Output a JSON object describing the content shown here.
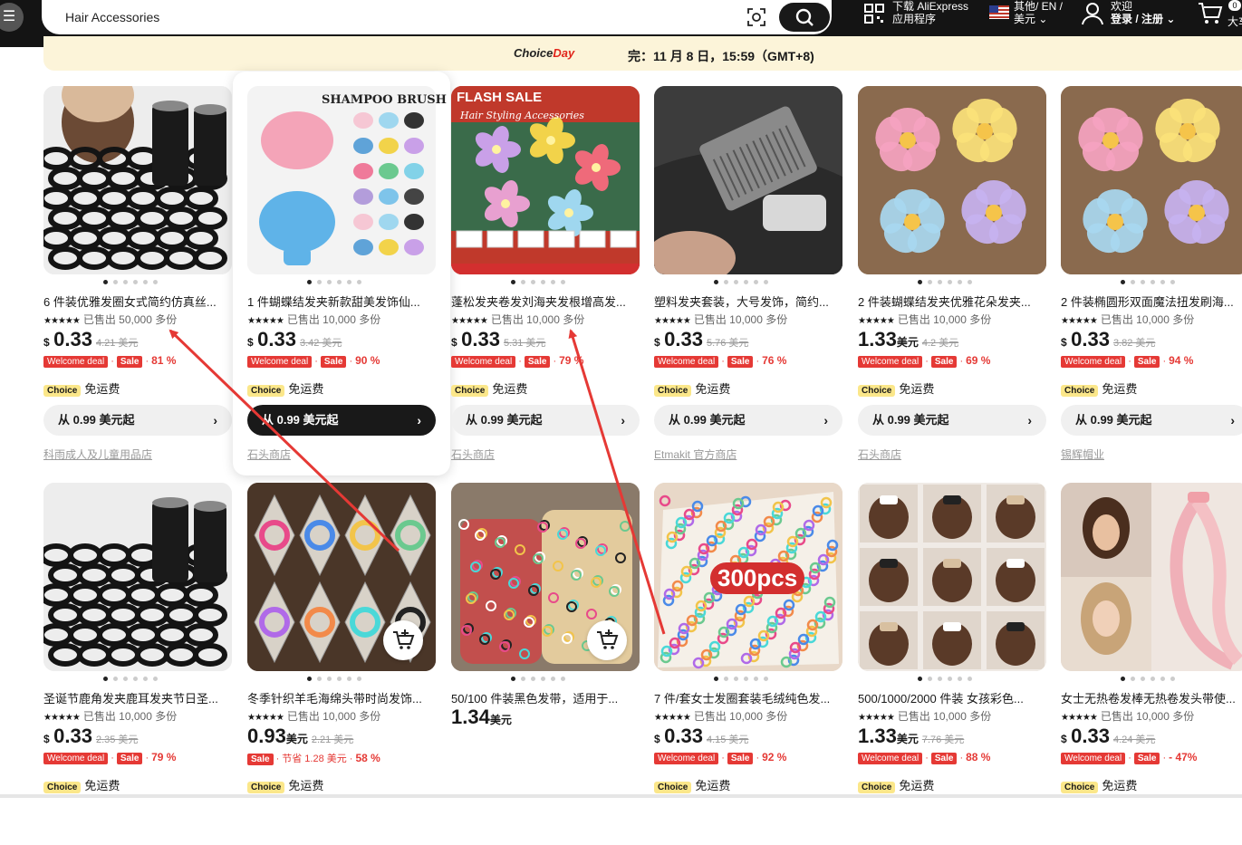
{
  "header": {
    "search_value": "Hair Accessories",
    "app_line1": "下载 AliExpress",
    "app_line2": "应用程序",
    "lang_line1": "其他/ EN /",
    "lang_line2": "美元",
    "user_line1": "欢迎",
    "user_line2": "登录 / 注册",
    "cart_count": "0",
    "cart_label": "大车"
  },
  "banner": {
    "logo_choice": "Choice",
    "logo_day": "Day",
    "text": "完：11 月 8 日，15:59（GMT+8)"
  },
  "colors": {
    "accent": "#e53935",
    "choice": "#fbe78a",
    "topbar": "#141414"
  },
  "products": [
    {
      "title": "6 件装优雅发圈女式简约仿真丝...",
      "sold": "已售出 50,000 多份",
      "cur": "$",
      "price": "0.33",
      "unit": "",
      "orig": "4.21 美元",
      "welcome": "Welcome deal",
      "sale": "Sale",
      "pct": "81 %",
      "choice": "Choice",
      "ship": "免运费",
      "from": "从 0.99 美元起",
      "store": "科雨成人及儿童用品店"
    },
    {
      "title": "1 件蝴蝶结发夹新款甜美发饰仙...",
      "sold": "已售出 10,000 多份",
      "cur": "$",
      "price": "0.33",
      "unit": "",
      "orig": "3.42 美元",
      "welcome": "Welcome deal",
      "sale": "Sale",
      "pct": "90 %",
      "choice": "Choice",
      "ship": "免运费",
      "from": "从 0.99 美元起",
      "store": "石头商店",
      "img_label": "SHAMPOO BRUSH"
    },
    {
      "title": "蓬松发夹卷发刘海夹发根增高发...",
      "sold": "已售出 10,000 多份",
      "cur": "$",
      "price": "0.33",
      "unit": "",
      "orig": "5.31 美元",
      "welcome": "Welcome deal",
      "sale": "Sale",
      "pct": "79 %",
      "choice": "Choice",
      "ship": "免运费",
      "from": "从 0.99 美元起",
      "store": "石头商店",
      "img_label": "FLASH SALE",
      "img_sub": "Hair Styling Accessories"
    },
    {
      "title": "塑料发夹套装，大号发饰，简约...",
      "sold": "已售出 10,000 多份",
      "cur": "$",
      "price": "0.33",
      "unit": "",
      "orig": "5.76 美元",
      "welcome": "Welcome deal",
      "sale": "Sale",
      "pct": "76 %",
      "choice": "Choice",
      "ship": "免运费",
      "from": "从 0.99 美元起",
      "store": "Etmakit 官方商店"
    },
    {
      "title": "2 件装蝴蝶结发夹优雅花朵发夹...",
      "sold": "已售出 10,000 多份",
      "cur": "",
      "price": "1.33",
      "unit": "美元",
      "orig": "4.2 美元",
      "welcome": "Welcome deal",
      "sale": "Sale",
      "pct": "69 %",
      "choice": "Choice",
      "ship": "免运费",
      "from": "从 0.99 美元起",
      "store": "石头商店"
    },
    {
      "title": "2 件装椭圆形双面魔法扭发刷海...",
      "sold": "已售出 10,000 多份",
      "cur": "$",
      "price": "0.33",
      "unit": "",
      "orig": "3.82 美元",
      "welcome": "Welcome deal",
      "sale": "Sale",
      "pct": "94 %",
      "choice": "Choice",
      "ship": "免运费",
      "from": "从 0.99 美元起",
      "store": "锡辉帽业"
    },
    {
      "title": "圣诞节鹿角发夹鹿耳发夹节日圣...",
      "sold": "已售出 10,000 多份",
      "cur": "$",
      "price": "0.33",
      "unit": "",
      "orig": "2.35 美元",
      "welcome": "Welcome deal",
      "sale": "Sale",
      "pct": "79 %",
      "choice": "Choice",
      "ship": "免运费"
    },
    {
      "title": "冬季针织羊毛海绵头带时尚发饰...",
      "sold": "已售出 10,000 多份",
      "cur": "",
      "price": "0.93",
      "unit": "美元",
      "orig": "2.21 美元",
      "welcome": "",
      "sale": "Sale",
      "save": "节省 1.28 美元",
      "pct": "58 %",
      "choice": "Choice",
      "ship": "免运费"
    },
    {
      "title": "50/100 件装黑色发带，适用于...",
      "sold": "",
      "cur": "",
      "price": "1.34",
      "unit": "美元",
      "orig": ""
    },
    {
      "title": "7 件/套女士发圈套装毛绒纯色发...",
      "sold": "已售出 10,000 多份",
      "cur": "$",
      "price": "0.33",
      "unit": "",
      "orig": "4.15 美元",
      "welcome": "Welcome deal",
      "sale": "Sale",
      "pct": "92 %",
      "choice": "Choice",
      "ship": "免运费",
      "img_label": "300pcs"
    },
    {
      "title": "500/1000/2000 件装 女孩彩色...",
      "sold": "已售出 10,000 多份",
      "cur": "",
      "price": "1.33",
      "unit": "美元",
      "orig": "7.76 美元",
      "welcome": "Welcome deal",
      "sale": "Sale",
      "pct": "88 %",
      "choice": "Choice",
      "ship": "免运费"
    },
    {
      "title": "女士无热卷发棒无热卷发头带使...",
      "sold": "已售出 10,000 多份",
      "cur": "$",
      "price": "0.33",
      "unit": "",
      "orig": "4.24 美元",
      "welcome": "Welcome deal",
      "sale": "Sale",
      "pct": "- 47%",
      "choice": "Choice",
      "ship": "免运费"
    }
  ]
}
